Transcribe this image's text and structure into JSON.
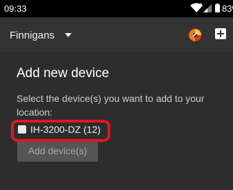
{
  "status_bar": {
    "time": "09:33",
    "battery": "83%",
    "icons": [
      "wifi-icon",
      "signal-icon",
      "battery-icon"
    ]
  },
  "app_bar": {
    "location_name": "Finnigans",
    "icons": [
      "chevron-down-icon",
      "app-logo-icon",
      "add-icon"
    ],
    "logo_colors": {
      "orange": "#f07a1a",
      "red": "#e8302a",
      "yellow": "#f6c62b"
    }
  },
  "main": {
    "title": "Add new device",
    "instruction": "Select the device(s) you want to add to your location:",
    "devices": [
      {
        "label": "IH-3200-DZ (12)",
        "checked": false
      }
    ],
    "add_button_label": "Add device(s)",
    "add_button_enabled": false
  },
  "colors": {
    "background": "#2d2d2d",
    "app_bar": "#333333",
    "highlight": "#e2161d",
    "button_disabled": "#555555"
  }
}
